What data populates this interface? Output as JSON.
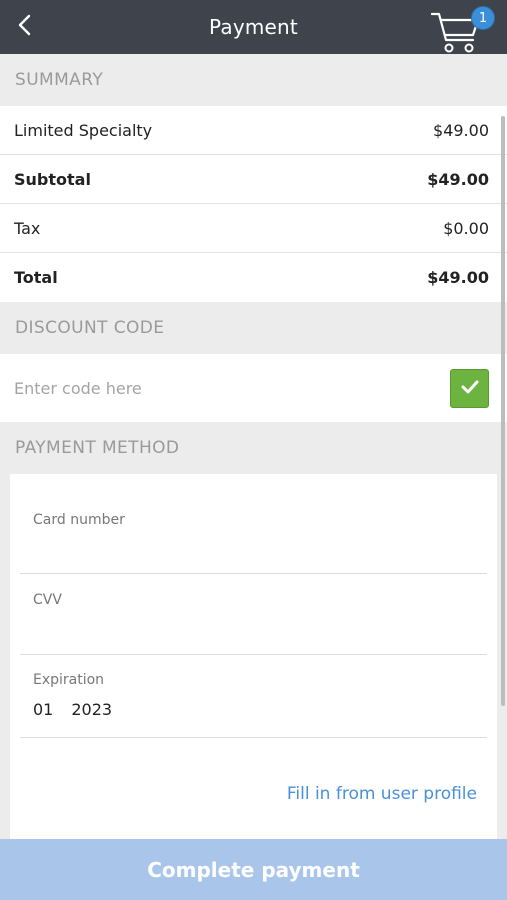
{
  "header": {
    "title": "Payment",
    "back_icon": "chevron-left-icon",
    "cart_icon": "cart-icon",
    "cart_count": "1"
  },
  "summary": {
    "heading": "SUMMARY",
    "items": [
      {
        "label": "Limited Specialty",
        "value": "$49.00",
        "bold": false
      },
      {
        "label": "Subtotal",
        "value": "$49.00",
        "bold": true
      },
      {
        "label": "Tax",
        "value": "$0.00",
        "bold": false
      },
      {
        "label": "Total",
        "value": "$49.00",
        "bold": true
      }
    ]
  },
  "discount": {
    "heading": "DISCOUNT CODE",
    "placeholder": "Enter code here",
    "value": "",
    "apply_icon": "checkmark-icon"
  },
  "payment_method": {
    "heading": "PAYMENT METHOD",
    "card_number_label": "Card number",
    "card_number_value": "",
    "cvv_label": "CVV",
    "cvv_value": "",
    "expiration_label": "Expiration",
    "expiration_month": "01",
    "expiration_year": "2023",
    "fill_link": "Fill in from user profile"
  },
  "footer": {
    "complete_label": "Complete payment"
  },
  "colors": {
    "topbar": "#3f444c",
    "badge": "#3b8fd9",
    "apply_button": "#6db33f",
    "link": "#4a90d9",
    "complete_button": "#a9c6ea"
  }
}
